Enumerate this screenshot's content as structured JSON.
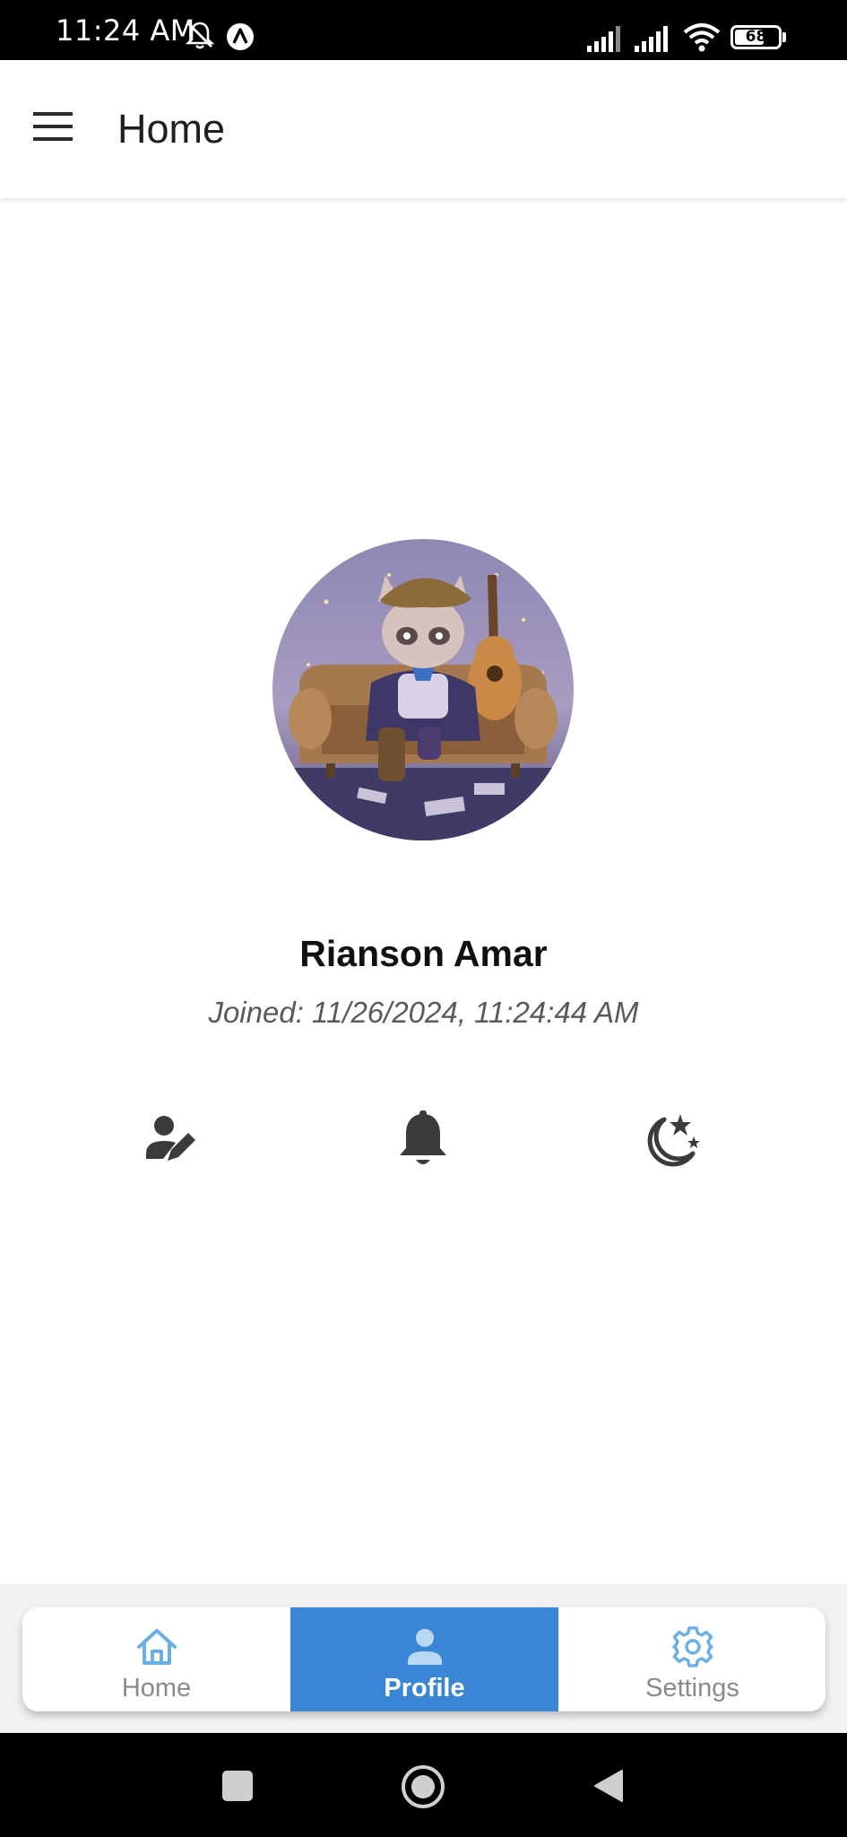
{
  "status_bar": {
    "time": "11:24 AM",
    "battery": "68",
    "battery_level": 0.68,
    "icons": [
      "bell-off-icon",
      "app-a-icon",
      "signal-icon",
      "signal-icon",
      "wifi-icon",
      "battery-icon"
    ]
  },
  "app_bar": {
    "title": "Home",
    "menu_icon": "hamburger-menu-icon"
  },
  "profile": {
    "name": "Rianson Amar",
    "joined": "Joined: 11/26/2024, 11:24:44 AM",
    "avatar": "avatar-illustration-raccoon-on-sofa-with-guitar",
    "actions": [
      {
        "icon": "edit-profile-icon"
      },
      {
        "icon": "notifications-bell-icon"
      },
      {
        "icon": "dark-mode-moon-icon"
      }
    ]
  },
  "bottom_nav": {
    "items": [
      {
        "label": "Home",
        "icon": "home-icon",
        "active": false
      },
      {
        "label": "Profile",
        "icon": "person-icon",
        "active": true
      },
      {
        "label": "Settings",
        "icon": "gear-icon",
        "active": false
      }
    ]
  },
  "system_nav": {
    "icons": [
      "recents-square-icon",
      "home-circle-icon",
      "back-triangle-icon"
    ]
  },
  "colors": {
    "accent": "#3a86d4",
    "icon_light_blue": "#6aaee6",
    "icon_dark": "#3b3b3b",
    "nav_label": "#8a8a8a"
  }
}
